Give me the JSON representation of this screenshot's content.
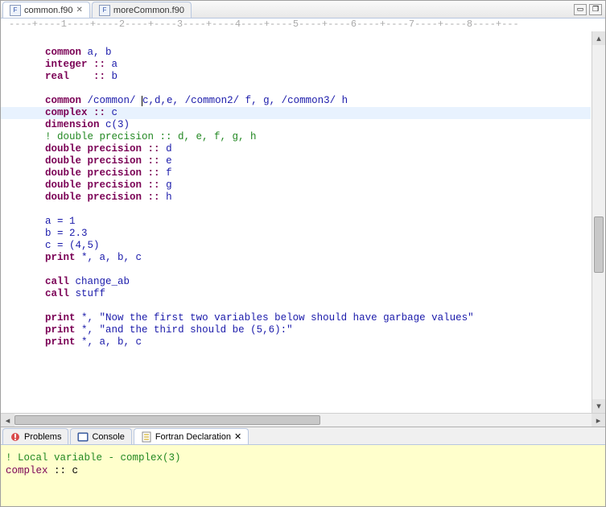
{
  "tabs": [
    {
      "label": "common.f90",
      "active": true
    },
    {
      "label": "moreCommon.f90",
      "active": false
    }
  ],
  "ruler": "----+----1----+----2----+----3----+----4----+----5----+----6----+----7----+----8----+---",
  "code": {
    "l1a": "common",
    "l1b": " a, b",
    "l2a": "integer",
    "l2b": " :: ",
    "l2c": "a",
    "l3a": "real",
    "l3b": "    :: ",
    "l3c": "b",
    "l4a": "common",
    "l4b": " /common/ ",
    "l4c": "c,d,e, ",
    "l4d": "/common2/",
    "l4e": " f, g, ",
    "l4f": "/common3/",
    "l4g": " h",
    "l5a": "complex",
    "l5b": " :: ",
    "l5c": "c",
    "l6a": "dimension",
    "l6b": " c(3)",
    "l7": "! double precision :: d, e, f, g, h",
    "l8a": "double precision",
    "l8b": " :: ",
    "l8c": "d",
    "l9a": "double precision",
    "l9b": " :: ",
    "l9c": "e",
    "l10a": "double precision",
    "l10b": " :: ",
    "l10c": "f",
    "l11a": "double precision",
    "l11b": " :: ",
    "l11c": "g",
    "l12a": "double precision",
    "l12b": " :: ",
    "l12c": "h",
    "l13": "a = 1",
    "l14": "b = 2.3",
    "l15": "c = (4,5)",
    "l16a": "print",
    "l16b": " *, a, b, c",
    "l17a": "call",
    "l17b": " change_ab",
    "l18a": "call",
    "l18b": " stuff",
    "l19a": "print",
    "l19b": " *, ",
    "l19c": "\"Now the first two variables below should have garbage values\"",
    "l20a": "print",
    "l20b": " *, ",
    "l20c": "\"and the third should be (5,6):\"",
    "l21a": "print",
    "l21b": " *, a, b, c"
  },
  "indent": "      ",
  "bottom_tabs": [
    {
      "label": "Problems",
      "icon": "problems",
      "active": false
    },
    {
      "label": "Console",
      "icon": "console",
      "active": false
    },
    {
      "label": "Fortran Declaration",
      "icon": "decl",
      "active": true
    }
  ],
  "declaration": {
    "comment": "! Local variable - complex(3)",
    "kw": "complex",
    "rest": " :: c"
  }
}
